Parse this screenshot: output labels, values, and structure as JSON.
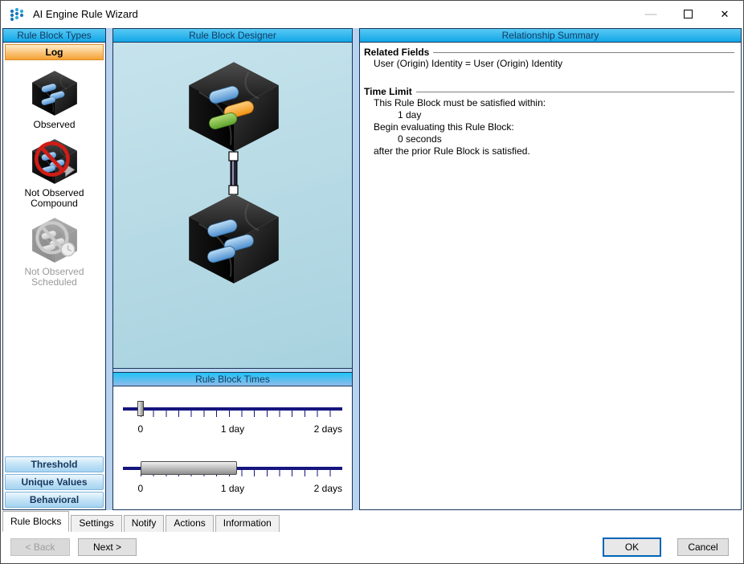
{
  "window": {
    "title": "AI Engine Rule Wizard",
    "controls": {
      "minimize": "—",
      "close": "✕"
    }
  },
  "left_panel": {
    "header": "Rule Block Types",
    "category_button": "Log",
    "types": [
      {
        "label": "Observed",
        "enabled": true
      },
      {
        "label": "Not Observed Compound",
        "enabled": true
      },
      {
        "label": "Not Observed Scheduled",
        "enabled": false
      }
    ],
    "bottom_buttons": [
      "Threshold",
      "Unique Values",
      "Behavioral"
    ]
  },
  "designer": {
    "header": "Rule Block Designer"
  },
  "times": {
    "header": "Rule Block Times",
    "slider1": {
      "labels": [
        "0",
        "1 day",
        "2 days"
      ]
    },
    "slider2": {
      "labels": [
        "0",
        "1 day",
        "2 days"
      ]
    }
  },
  "summary": {
    "header": "Relationship Summary",
    "related_fields": {
      "title": "Related Fields",
      "value": "User (Origin) Identity = User (Origin) Identity"
    },
    "time_limit": {
      "title": "Time Limit",
      "line1": "This Rule Block must be satisfied within:",
      "line2": "1 day",
      "line3": "Begin evaluating this Rule Block:",
      "line4": "0 seconds",
      "line5": "after the prior Rule Block is satisfied."
    }
  },
  "tabs": [
    "Rule Blocks",
    "Settings",
    "Notify",
    "Actions",
    "Information"
  ],
  "footer": {
    "back": "< Back",
    "next": "Next >",
    "ok": "OK",
    "cancel": "Cancel"
  },
  "colors": {
    "header_blue_top": "#5ac9f3",
    "header_blue_bottom": "#12a7e8",
    "header_text": "#123c63",
    "log_orange": "#f6a133",
    "side_button_text": "#17375e",
    "slider_track": "#15157e",
    "ok_focus_border": "#0065b8"
  }
}
